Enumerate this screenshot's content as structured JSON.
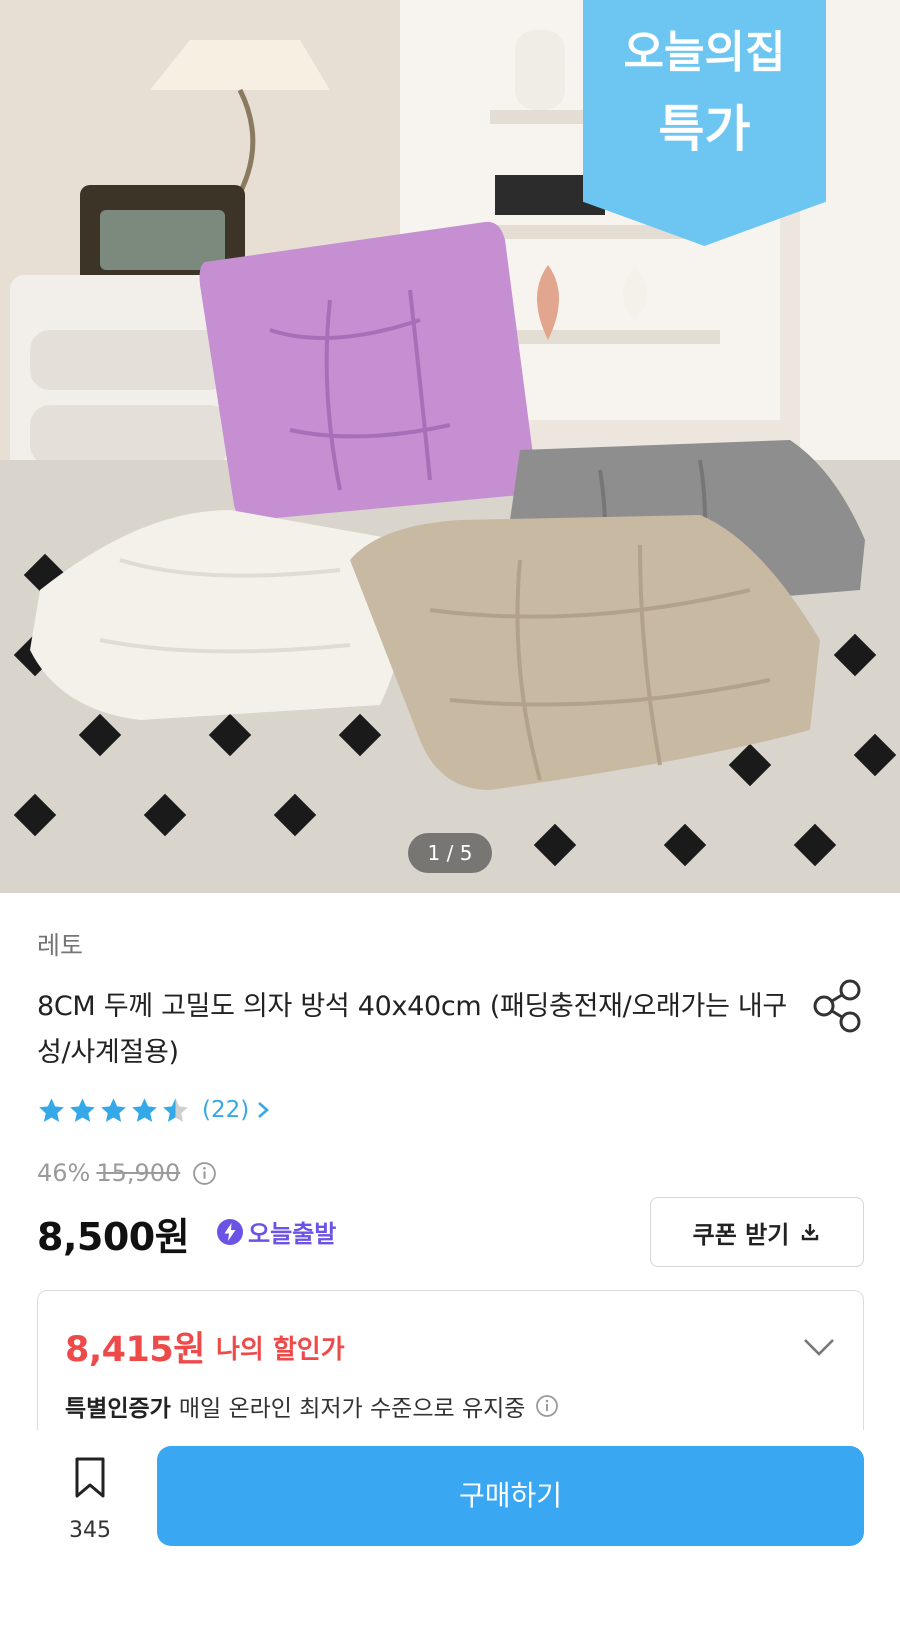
{
  "hero": {
    "image_counter": "1 / 5",
    "badge": {
      "line1": "오늘의집",
      "line2": "특가"
    }
  },
  "product": {
    "brand": "레토",
    "title": "8CM 두께 고밀도 의자 방석 40x40cm (패딩충전재/오래가는 내구성/사계절용)",
    "rating": {
      "score": 4.5,
      "max": 5,
      "review_count_label": "(22)"
    },
    "discount_percent": "46%",
    "original_price": "15,900",
    "price": "8,500원",
    "delivery_badge": "오늘출발",
    "coupon_button": "쿠폰 받기"
  },
  "my_discount": {
    "price": "8,415원",
    "label": "나의 할인가",
    "cert_strong": "특별인증가",
    "cert_text": "매일 온라인 최저가 수준으로 유지중"
  },
  "bottom_bar": {
    "bookmark_count": "345",
    "buy_button": "구매하기"
  },
  "colors": {
    "accent_blue": "#3aa7f3",
    "star_blue": "#35a9e7",
    "discount_red": "#ee4a4a",
    "today_purple": "#6b53e6",
    "badge_sky": "#6cc6f1"
  },
  "icons": [
    "share-icon",
    "star-icon",
    "chevron-right-icon",
    "info-icon",
    "lightning-icon",
    "download-icon",
    "chevron-down-icon",
    "bookmark-icon"
  ]
}
